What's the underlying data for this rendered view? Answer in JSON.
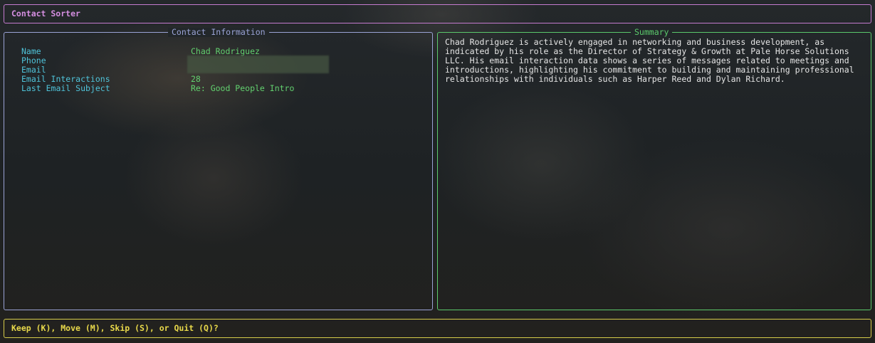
{
  "app": {
    "title": "Contact Sorter"
  },
  "contact_panel": {
    "title": "Contact Information",
    "fields": [
      {
        "key": "Name",
        "value": "Chad Rodriguez"
      },
      {
        "key": "Phone",
        "value": ""
      },
      {
        "key": "Email",
        "value": ""
      },
      {
        "key": "Email Interactions",
        "value": "28"
      },
      {
        "key": "Last Email Subject",
        "value": "Re: Good People Intro"
      }
    ]
  },
  "summary_panel": {
    "title": "Summary",
    "text": "Chad Rodriguez is actively engaged in networking and business development, as\nindicated by his role as the Director of Strategy & Growth at Pale Horse Solutions\nLLC. His email interaction data shows a series of messages related to meetings and\nintroductions, highlighting his commitment to building and maintaining professional\nrelationships with individuals such as Harper Reed and Dylan Richard."
  },
  "prompt": {
    "text": "Keep (K), Move (M), Skip (S), or Quit (Q)?"
  },
  "colors": {
    "title_border": "#c57bd0",
    "contact_border": "#9aa3d6",
    "summary_border": "#5bc96b",
    "prompt_border": "#d6cc4a",
    "field_key": "#4fc3d9",
    "field_value": "#62d16f"
  }
}
